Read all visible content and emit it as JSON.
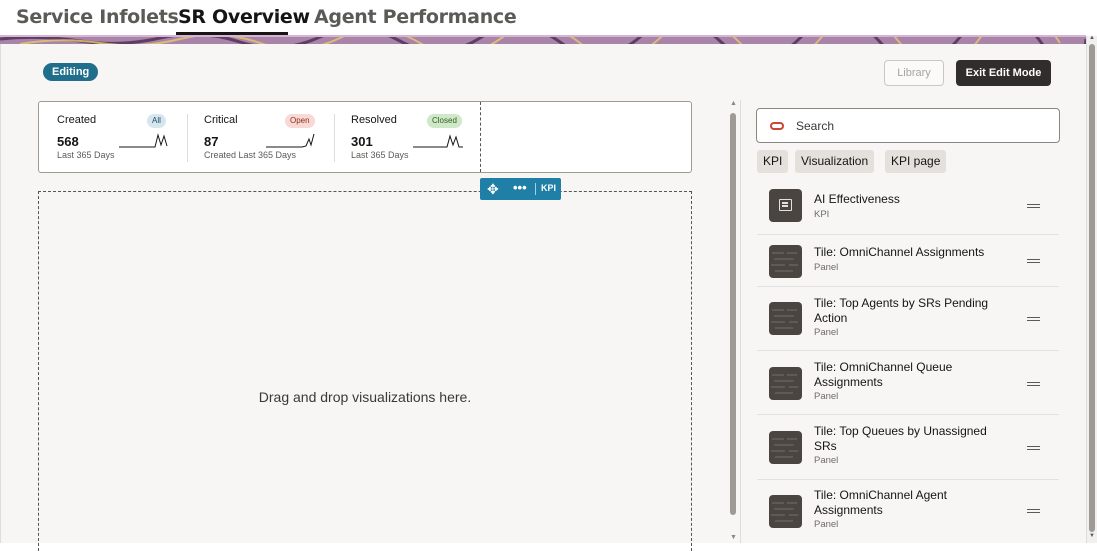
{
  "tabs": [
    {
      "label": "Service Infolets",
      "active": false
    },
    {
      "label": "SR Overview",
      "active": true
    },
    {
      "label": "Agent Performance",
      "active": false
    }
  ],
  "status_badge": "Editing",
  "buttons": {
    "library": "Library",
    "exit_edit_mode": "Exit Edit Mode"
  },
  "kpis": [
    {
      "title": "Created",
      "pill": "All",
      "pill_color": "#d6e6ef",
      "value": "568",
      "sub": "Last 365 Days"
    },
    {
      "title": "Critical",
      "pill": "Open",
      "pill_color": "#f8d9d3",
      "value": "87",
      "sub": "Created Last 365 Days"
    },
    {
      "title": "Resolved",
      "pill": "Closed",
      "pill_color": "#cfe8c8",
      "value": "301",
      "sub": "Last 365 Days"
    }
  ],
  "tile_toolbar": {
    "move_icon": "move-icon",
    "more_icon": "more-icon",
    "label": "KPI"
  },
  "dropzone": {
    "hint": "Drag and drop visualizations here."
  },
  "library_panel": {
    "search": {
      "placeholder": "Search",
      "value": ""
    },
    "filters": [
      "KPI",
      "Visualization",
      "KPI page"
    ],
    "items": [
      {
        "name": "AI Effectiveness",
        "type": "KPI",
        "icon": "kpi-icon"
      },
      {
        "name": "Tile: OmniChannel Assignments",
        "type": "Panel",
        "icon": "panel-thumbnail"
      },
      {
        "name": "Tile: Top Agents by SRs Pending Action",
        "type": "Panel",
        "icon": "panel-thumbnail"
      },
      {
        "name": "Tile: OmniChannel Queue Assignments",
        "type": "Panel",
        "icon": "panel-thumbnail"
      },
      {
        "name": "Tile: Top Queues by Unassigned SRs",
        "type": "Panel",
        "icon": "panel-thumbnail"
      },
      {
        "name": "Tile: OmniChannel Agent Assignments",
        "type": "Panel",
        "icon": "panel-thumbnail"
      }
    ]
  },
  "colors": {
    "accent": "#1f7fa6",
    "badge": "#1f6e8c",
    "dark_button": "#312d2a",
    "background": "#f8f6f4"
  }
}
